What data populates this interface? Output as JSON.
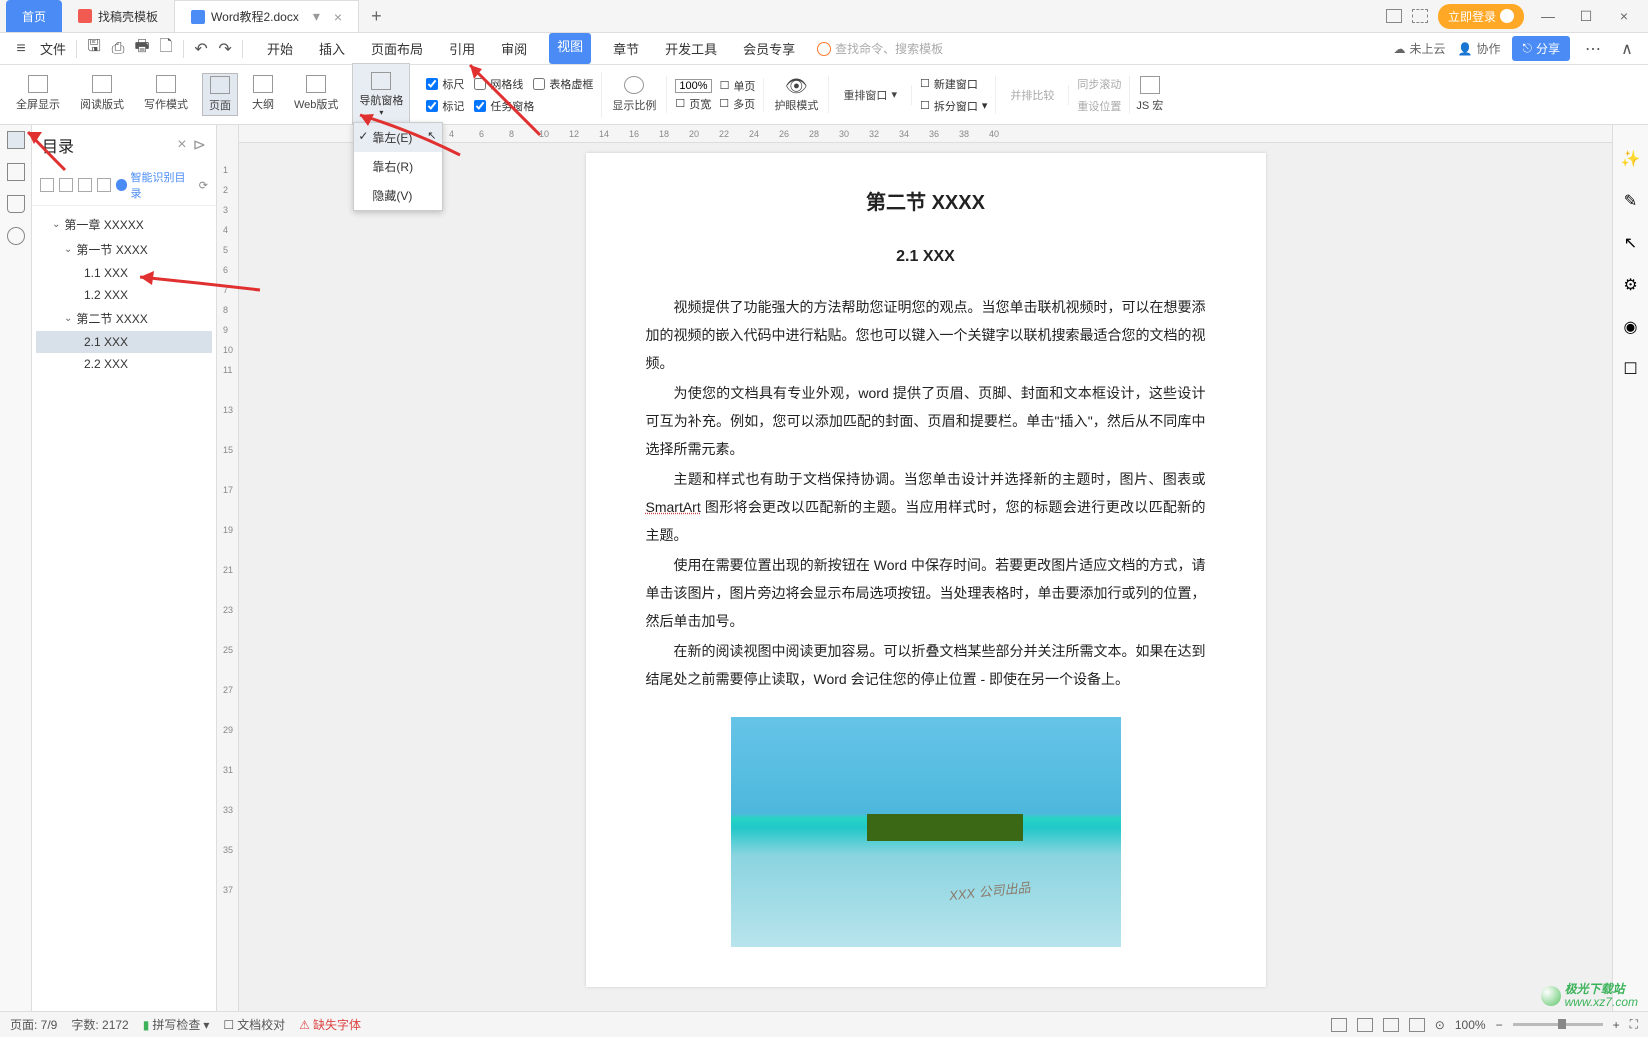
{
  "tabs": {
    "home": "首页",
    "template": "找稿壳模板",
    "doc": "Word教程2.docx"
  },
  "login_button": "立即登录",
  "menu": {
    "file": "文件",
    "items": [
      "开始",
      "插入",
      "页面布局",
      "引用",
      "审阅",
      "视图",
      "章节",
      "开发工具",
      "会员专享"
    ],
    "search_placeholder": "查找命令、搜索模板",
    "cloud": "未上云",
    "coop": "协作",
    "share": "分享"
  },
  "ribbon": {
    "fullscreen": "全屏显示",
    "reading": "阅读版式",
    "writing": "写作模式",
    "page": "页面",
    "outline": "大纲",
    "web": "Web版式",
    "nav_pane": "导航窗格",
    "ruler": "标尺",
    "grid": "网格线",
    "table_grid": "表格虚框",
    "mark": "标记",
    "task_pane": "任务窗格",
    "ratio": "显示比例",
    "percent": "100%",
    "single": "单页",
    "width": "页宽",
    "multi": "多页",
    "eye": "护眼模式",
    "rearrange": "重排窗口",
    "new_win": "新建窗口",
    "split": "拆分窗口",
    "compare": "并排比较",
    "sync": "同步滚动",
    "reset": "重设位置",
    "jsmacro": "JS 宏"
  },
  "nav_dropdown": {
    "left": "靠左(E)",
    "right": "靠右(R)",
    "hide": "隐藏(V)"
  },
  "outline": {
    "title": "目录",
    "smart": "智能识别目录",
    "items": {
      "ch1": "第一章  XXXXX",
      "s1": "第一节  XXXX",
      "s1_1": "1.1 XXX",
      "s1_2": "1.2 XXX",
      "s2": "第二节  XXXX",
      "s2_1": "2.1 XXX",
      "s2_2": "2.2 XXX"
    }
  },
  "document": {
    "heading": "第二节  XXXX",
    "subheading": "2.1 XXX",
    "p1": "视频提供了功能强大的方法帮助您证明您的观点。当您单击联机视频时，可以在想要添加的视频的嵌入代码中进行粘贴。您也可以键入一个关键字以联机搜索最适合您的文档的视频。",
    "p2a": "为使您的文档具有专业外观，word 提供了页眉、页脚、封面和文本框设计，这些设计可互为补充。例如，您可以添加匹配的封面、页眉和提要栏。单击",
    "p2b": "，然后从不同库中选择所需元素。",
    "p2quote": "\"插入\"",
    "p3a": "主题和样式也有助于文档保持协调。当您单击设计并选择新的主题时，图片、图表或 ",
    "p3b": " 图形将会更改以匹配新的主题。当应用样式时，您的标题会进行更改以匹配新的主题。",
    "smartart": "SmartArt",
    "p4": "使用在需要位置出现的新按钮在 Word 中保存时间。若要更改图片适应文档的方式，请单击该图片，图片旁边将会显示布局选项按钮。当处理表格时，单击要添加行或列的位置，然后单击加号。",
    "p5": "在新的阅读视图中阅读更加容易。可以折叠文档某些部分并关注所需文本。如果在达到结尾处之前需要停止读取，Word 会记住您的停止位置 - 即使在另一个设备上。",
    "img_watermark": "XXX 公司出品"
  },
  "status": {
    "page": "页面: 7/9",
    "words": "字数: 2172",
    "spell": "拼写检查",
    "proof": "文档校对",
    "missing_font": "缺失字体",
    "zoom": "100%"
  },
  "watermark": "www.xz7.com",
  "watermark_label": "极光下载站"
}
